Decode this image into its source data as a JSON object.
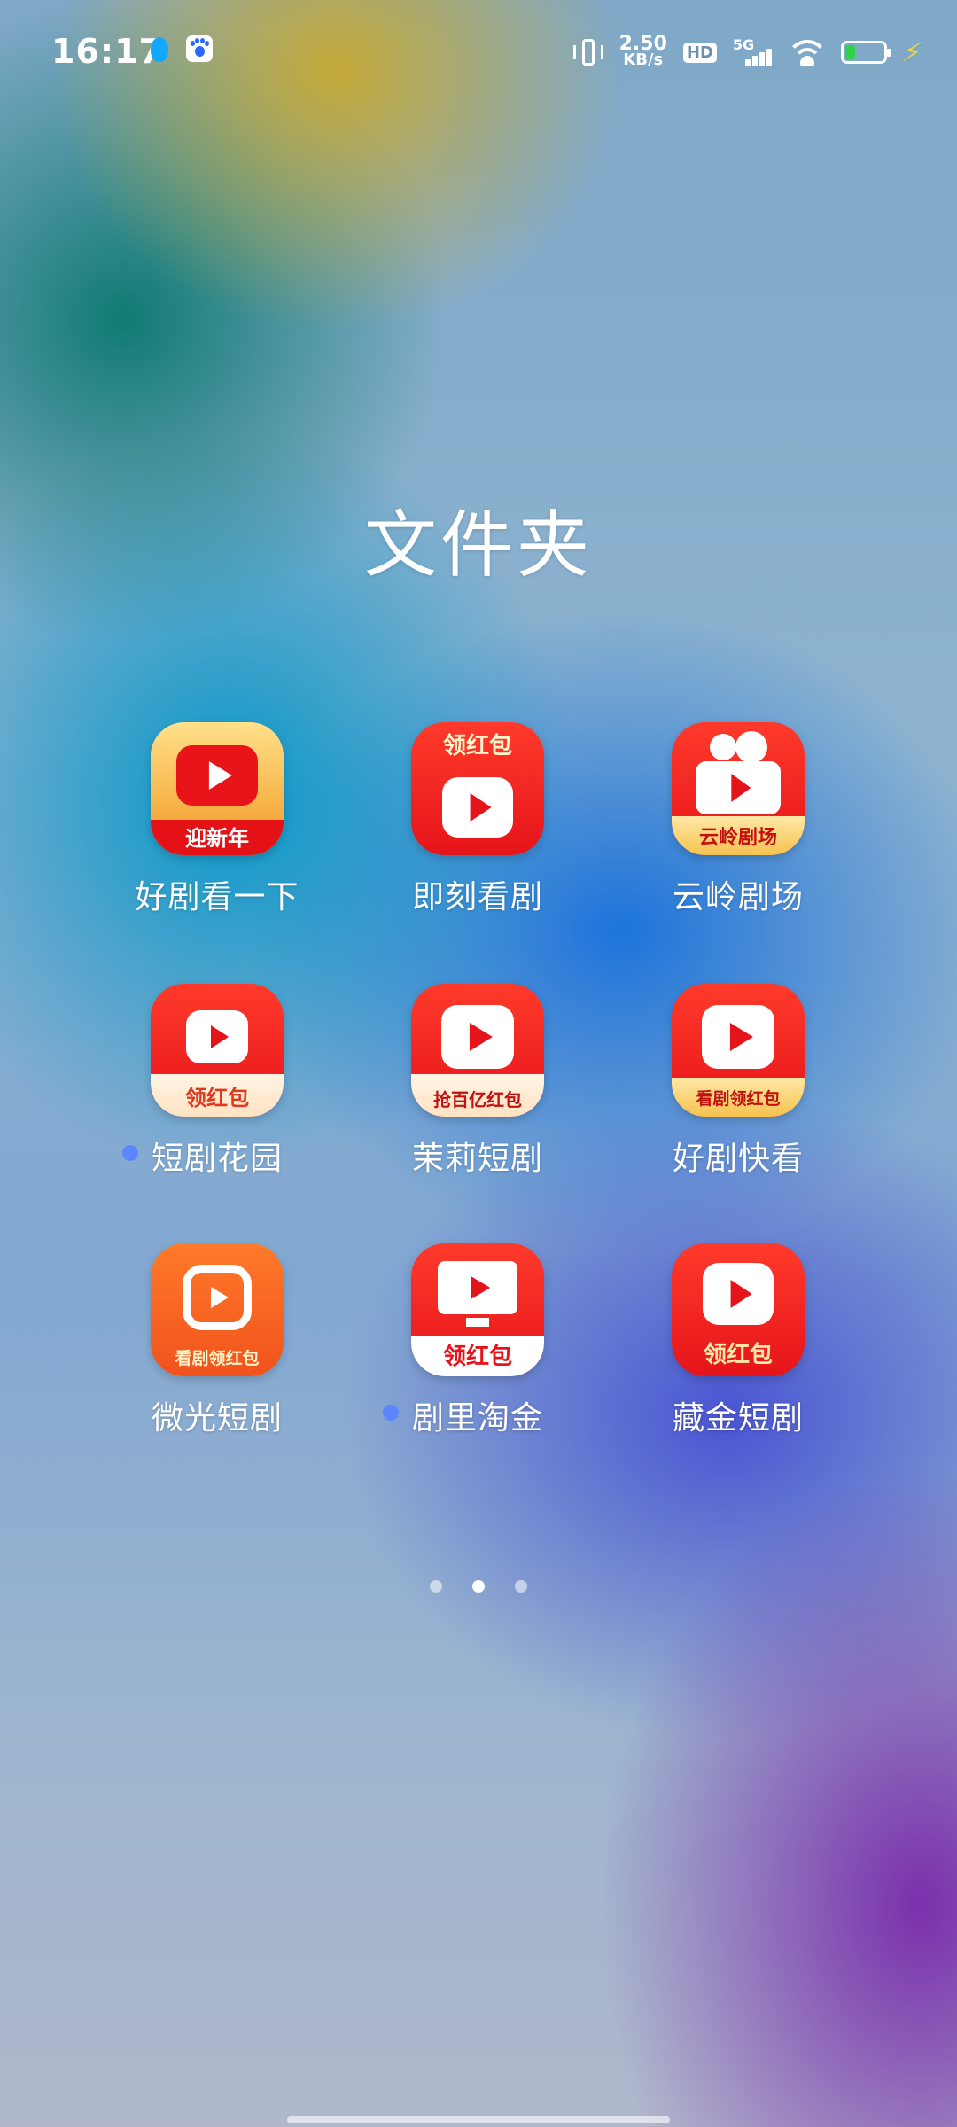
{
  "status_bar": {
    "time": "16:17",
    "net_speed_value": "2.50",
    "net_speed_unit": "KB/s",
    "hd": "HD",
    "network": "5G",
    "battery_level": 0.25,
    "icons": [
      "qq-icon",
      "baidu-icon",
      "vibrate-icon",
      "signal-icon",
      "wifi-icon",
      "battery-icon",
      "charging-icon"
    ]
  },
  "folder": {
    "title": "文件夹",
    "apps": [
      {
        "label": "好剧看一下",
        "badge_text": "迎新年",
        "has_dot": false
      },
      {
        "label": "即刻看剧",
        "badge_text": "领红包",
        "has_dot": false
      },
      {
        "label": "云岭剧场",
        "badge_text": "云岭剧场",
        "has_dot": false
      },
      {
        "label": "短剧花园",
        "badge_text": "领红包",
        "has_dot": true
      },
      {
        "label": "茉莉短剧",
        "badge_text": "抢百亿红包",
        "has_dot": false
      },
      {
        "label": "好剧快看",
        "badge_text": "看剧领红包",
        "has_dot": false
      },
      {
        "label": "微光短剧",
        "badge_text": "看剧领红包",
        "has_dot": false
      },
      {
        "label": "剧里淘金",
        "badge_text": "领红包",
        "has_dot": true
      },
      {
        "label": "藏金短剧",
        "badge_text": "领红包",
        "has_dot": false
      }
    ]
  },
  "pager": {
    "pages": 3,
    "current": 2
  },
  "colors": {
    "accent_red": "#e5141a",
    "dot_blue": "#5c86ff"
  }
}
